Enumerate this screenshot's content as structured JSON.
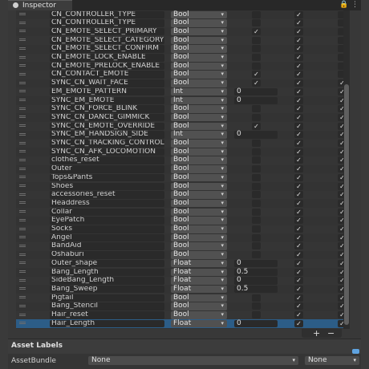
{
  "window": {
    "tab_label": "Inspector",
    "lock_glyph": "🔒",
    "menu_glyph": "⋮"
  },
  "parameters": [
    {
      "name": "CN_CONTROLLER_TYPE",
      "type": "Bool",
      "default": "",
      "c1": false,
      "c2": true,
      "c3": false
    },
    {
      "name": "CN_CONTROLLER_TYPE",
      "type": "Bool",
      "default": "",
      "c1": false,
      "c2": true,
      "c3": false
    },
    {
      "name": "CN_EMOTE_SELECT_PRIMARY",
      "type": "Bool",
      "default": "",
      "c1": true,
      "c2": true,
      "c3": false
    },
    {
      "name": "CN_EMOTE_SELECT_CATEGORY",
      "type": "Bool",
      "default": "",
      "c1": false,
      "c2": true,
      "c3": false
    },
    {
      "name": "CN_EMOTE_SELECT_CONFIRM",
      "type": "Bool",
      "default": "",
      "c1": false,
      "c2": true,
      "c3": false
    },
    {
      "name": "CN_EMOTE_LOCK_ENABLE",
      "type": "Bool",
      "default": "",
      "c1": false,
      "c2": true,
      "c3": false
    },
    {
      "name": "CN_EMOTE_PRELOCK_ENABLE",
      "type": "Bool",
      "default": "",
      "c1": false,
      "c2": true,
      "c3": false
    },
    {
      "name": "CN_CONTACT_EMOTE",
      "type": "Bool",
      "default": "",
      "c1": true,
      "c2": true,
      "c3": false
    },
    {
      "name": "SYNC_CN_WAIT_FACE",
      "type": "Bool",
      "default": "",
      "c1": true,
      "c2": true,
      "c3": true
    },
    {
      "name": "EM_EMOTE_PATTERN",
      "type": "Int",
      "default": "0",
      "c1": false,
      "c2": true,
      "c3": true
    },
    {
      "name": "SYNC_EM_EMOTE",
      "type": "Int",
      "default": "0",
      "c1": false,
      "c2": true,
      "c3": true
    },
    {
      "name": "SYNC_CN_FORCE_BLINK",
      "type": "Bool",
      "default": "",
      "c1": false,
      "c2": true,
      "c3": true
    },
    {
      "name": "SYNC_CN_DANCE_GIMMICK",
      "type": "Bool",
      "default": "",
      "c1": false,
      "c2": true,
      "c3": true
    },
    {
      "name": "SYNC_CN_EMOTE_OVERRIDE",
      "type": "Bool",
      "default": "",
      "c1": true,
      "c2": true,
      "c3": true
    },
    {
      "name": "SYNC_EM_HANDSIGN_SIDE",
      "type": "Int",
      "default": "0",
      "c1": false,
      "c2": true,
      "c3": true
    },
    {
      "name": "SYNC_CN_TRACKING_CONTROL",
      "type": "Bool",
      "default": "",
      "c1": false,
      "c2": true,
      "c3": true
    },
    {
      "name": "SYNC_CN_AFK_LOCOMOTION",
      "type": "Bool",
      "default": "",
      "c1": false,
      "c2": true,
      "c3": true
    },
    {
      "name": "clothes_reset",
      "type": "Bool",
      "default": "",
      "c1": false,
      "c2": true,
      "c3": true
    },
    {
      "name": "Outer",
      "type": "Bool",
      "default": "",
      "c1": false,
      "c2": true,
      "c3": true
    },
    {
      "name": "Tops&Pants",
      "type": "Bool",
      "default": "",
      "c1": false,
      "c2": true,
      "c3": true
    },
    {
      "name": "Shoes",
      "type": "Bool",
      "default": "",
      "c1": false,
      "c2": true,
      "c3": true
    },
    {
      "name": "accessories_reset",
      "type": "Bool",
      "default": "",
      "c1": false,
      "c2": true,
      "c3": true
    },
    {
      "name": "Headdress",
      "type": "Bool",
      "default": "",
      "c1": false,
      "c2": true,
      "c3": true
    },
    {
      "name": "Collar",
      "type": "Bool",
      "default": "",
      "c1": false,
      "c2": true,
      "c3": true
    },
    {
      "name": "EyePatch",
      "type": "Bool",
      "default": "",
      "c1": false,
      "c2": true,
      "c3": true
    },
    {
      "name": "Socks",
      "type": "Bool",
      "default": "",
      "c1": false,
      "c2": true,
      "c3": true
    },
    {
      "name": "Angel",
      "type": "Bool",
      "default": "",
      "c1": false,
      "c2": true,
      "c3": true
    },
    {
      "name": "BandAid",
      "type": "Bool",
      "default": "",
      "c1": false,
      "c2": true,
      "c3": true
    },
    {
      "name": "Oshaburi",
      "type": "Bool",
      "default": "",
      "c1": false,
      "c2": true,
      "c3": true
    },
    {
      "name": "Outer_shape",
      "type": "Float",
      "default": "0",
      "c1": false,
      "c2": true,
      "c3": true
    },
    {
      "name": "Bang_Length",
      "type": "Float",
      "default": "0.5",
      "c1": false,
      "c2": true,
      "c3": true
    },
    {
      "name": "SideBang_Length",
      "type": "Float",
      "default": "0",
      "c1": false,
      "c2": true,
      "c3": true
    },
    {
      "name": "Bang_Sweep",
      "type": "Float",
      "default": "0.5",
      "c1": false,
      "c2": true,
      "c3": true
    },
    {
      "name": "Pigtail",
      "type": "Bool",
      "default": "",
      "c1": false,
      "c2": true,
      "c3": true
    },
    {
      "name": "Bang_Stencil",
      "type": "Bool",
      "default": "",
      "c1": false,
      "c2": true,
      "c3": true
    },
    {
      "name": "Hair_reset",
      "type": "Bool",
      "default": "",
      "c1": false,
      "c2": true,
      "c3": true
    },
    {
      "name": "Hair_Length",
      "type": "Float",
      "default": "0",
      "c1": false,
      "c2": true,
      "c3": true,
      "selected": true
    }
  ],
  "list_footer": {
    "add_label": "+",
    "remove_label": "−"
  },
  "asset_labels": {
    "title": "Asset Labels"
  },
  "asset_bundle": {
    "label": "AssetBundle",
    "value": "None",
    "variant": "None"
  },
  "colors": {
    "selected_row": "#2c5d87",
    "panel": "#383838",
    "checkmark": "#e6e6e6"
  }
}
